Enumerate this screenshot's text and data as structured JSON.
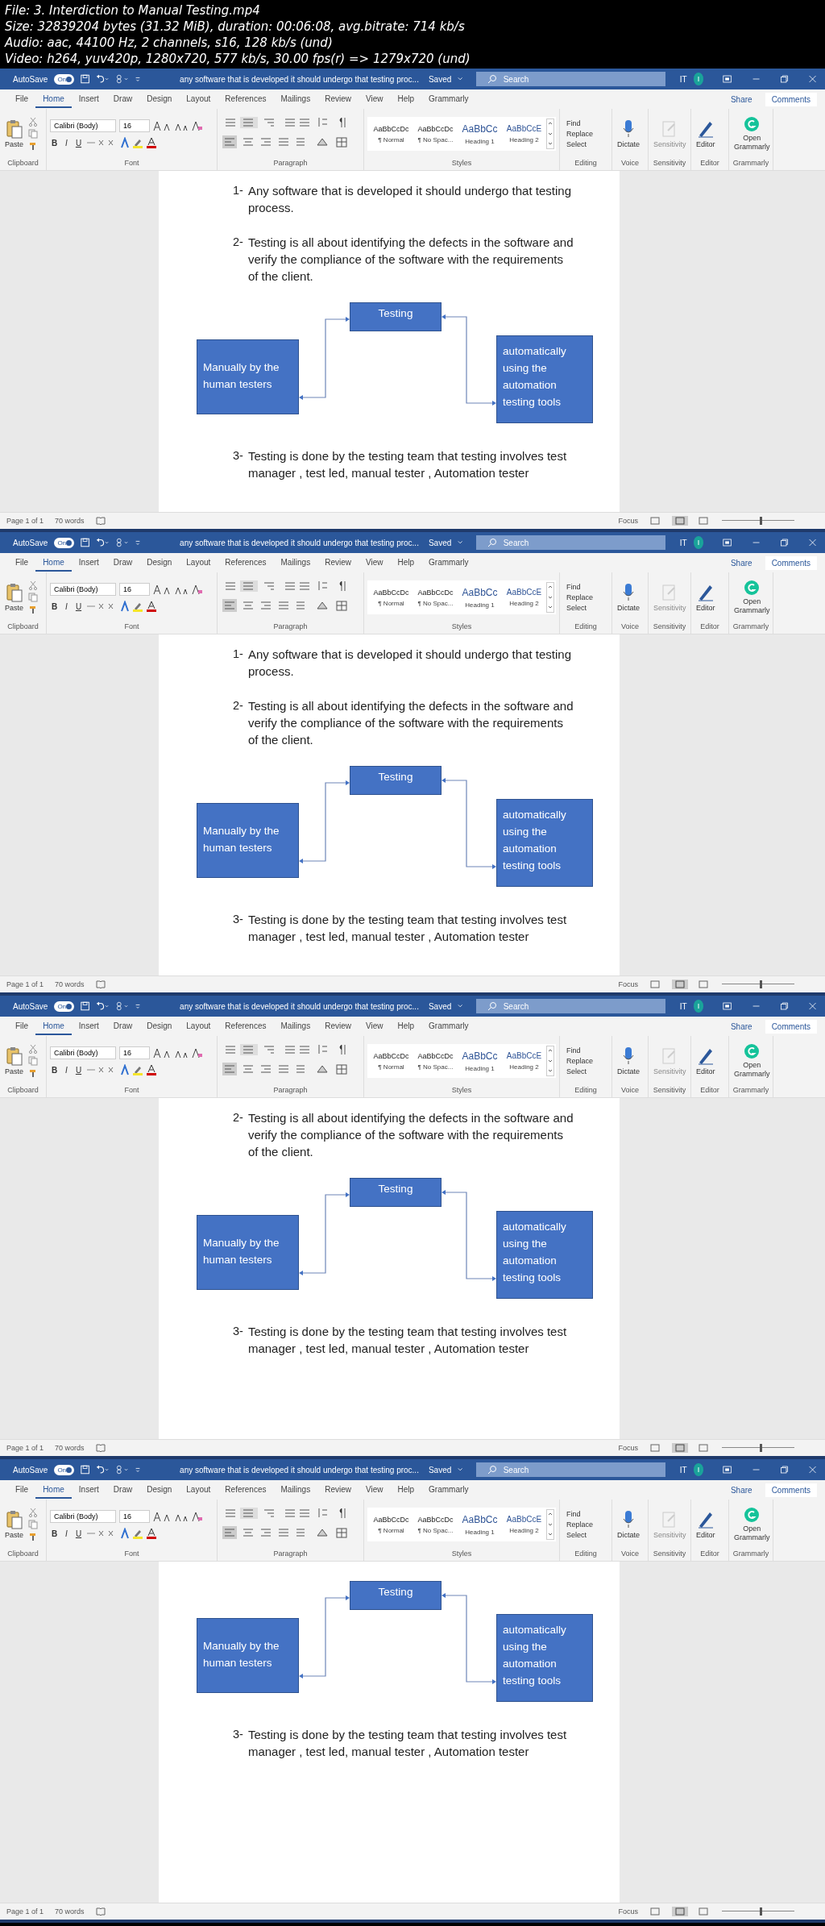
{
  "header": [
    "File: 3. Interdiction to Manual Testing.mp4",
    "Size: 32839204 bytes (31.32 MiB), duration: 00:06:08, avg.bitrate: 714 kb/s",
    "Audio: aac, 44100 Hz, 2 channels, s16, 128 kb/s (und)",
    "Video: h264, yuv420p, 1280x720, 577 kb/s, 30.00 fps(r) => 1279x720 (und)"
  ],
  "frames": [
    {
      "title_bar": {
        "autosave": "AutoSave",
        "toggle": "On",
        "toggle_on": true,
        "doc_title": "any software that is developed it should undergo that testing proc...",
        "saved": "Saved",
        "search": "Search",
        "initials": "IT",
        "avatar": "I"
      },
      "tabs": [
        {
          "label": "File",
          "selected": false
        },
        {
          "label": "Home",
          "selected": true
        },
        {
          "label": "Insert",
          "selected": false
        },
        {
          "label": "Draw",
          "selected": false
        },
        {
          "label": "Design",
          "selected": false
        },
        {
          "label": "Layout",
          "selected": false
        },
        {
          "label": "References",
          "selected": false
        },
        {
          "label": "Mailings",
          "selected": false
        },
        {
          "label": "Review",
          "selected": false
        },
        {
          "label": "View",
          "selected": false
        },
        {
          "label": "Help",
          "selected": false
        },
        {
          "label": "Grammarly",
          "selected": false
        }
      ],
      "share": "Share",
      "comments": "Comments",
      "groups": [
        {
          "kind": "clipboard",
          "label": "Clipboard",
          "button": "Paste"
        },
        {
          "kind": "font",
          "label": "Font",
          "font_name": "Calibri (Body)",
          "font_size": "16",
          "buttons": [
            "B",
            "I",
            "U"
          ]
        },
        {
          "kind": "paragraph",
          "label": "Paragraph"
        },
        {
          "kind": "styles",
          "label": "Styles",
          "styles": [
            {
              "preview": "AaBbCcDc",
              "name": "¶ Normal",
              "kind": "body"
            },
            {
              "preview": "AaBbCcDc",
              "name": "¶ No Spac...",
              "kind": "body"
            },
            {
              "preview": "AaBbCc",
              "name": "Heading 1",
              "kind": "heading1"
            },
            {
              "preview": "AaBbCcE",
              "name": "Heading 2",
              "kind": "heading2"
            }
          ]
        },
        {
          "kind": "editing",
          "label": "Editing",
          "find": "Find",
          "replace": "Replace",
          "select": "Select"
        },
        {
          "kind": "voice",
          "label": "Voice",
          "button": "Dictate"
        },
        {
          "kind": "sensitivity",
          "label": "Sensitivity",
          "button": "Sensitivity",
          "disabled": true
        },
        {
          "kind": "editor",
          "label": "Editor",
          "button": "Editor"
        },
        {
          "kind": "grammarly",
          "label": "Grammarly",
          "button": "Open Grammarly"
        }
      ],
      "blocks": [
        {
          "kind": "item",
          "number": "1-",
          "text": "Any software that is developed it should undergo that testing process."
        },
        {
          "kind": "item",
          "number": "2-",
          "text": "Testing is all about identifying the defects in the software and verify the compliance of the software with the requirements of the client."
        },
        {
          "kind": "diagram",
          "center": "Testing",
          "left": "Manually by the human testers",
          "right": "automatically using the automation testing tools"
        },
        {
          "kind": "item",
          "number": "3-",
          "text": "Testing is done by the testing team that testing involves  test manager , test led, manual tester , Automation tester"
        }
      ],
      "status": {
        "page": "Page 1 of 1",
        "words": "70 words",
        "focus": "Focus",
        "level": 0.52
      }
    },
    {
      "title_bar": {
        "autosave": "AutoSave",
        "toggle": "On",
        "toggle_on": true,
        "doc_title": "any software that is developed it should undergo that testing proc...",
        "saved": "Saved",
        "search": "Search",
        "initials": "IT",
        "avatar": "I"
      },
      "tabs": [
        {
          "label": "File",
          "selected": false
        },
        {
          "label": "Home",
          "selected": true
        },
        {
          "label": "Insert",
          "selected": false
        },
        {
          "label": "Draw",
          "selected": false
        },
        {
          "label": "Design",
          "selected": false
        },
        {
          "label": "Layout",
          "selected": false
        },
        {
          "label": "References",
          "selected": false
        },
        {
          "label": "Mailings",
          "selected": false
        },
        {
          "label": "Review",
          "selected": false
        },
        {
          "label": "View",
          "selected": false
        },
        {
          "label": "Help",
          "selected": false
        },
        {
          "label": "Grammarly",
          "selected": false
        }
      ],
      "share": "Share",
      "comments": "Comments",
      "groups": [
        {
          "kind": "clipboard",
          "label": "Clipboard",
          "button": "Paste"
        },
        {
          "kind": "font",
          "label": "Font",
          "font_name": "Calibri (Body)",
          "font_size": "16",
          "buttons": [
            "B",
            "I",
            "U"
          ]
        },
        {
          "kind": "paragraph",
          "label": "Paragraph"
        },
        {
          "kind": "styles",
          "label": "Styles",
          "styles": [
            {
              "preview": "AaBbCcDc",
              "name": "¶ Normal",
              "kind": "body"
            },
            {
              "preview": "AaBbCcDc",
              "name": "¶ No Spac...",
              "kind": "body"
            },
            {
              "preview": "AaBbCc",
              "name": "Heading 1",
              "kind": "heading1"
            },
            {
              "preview": "AaBbCcE",
              "name": "Heading 2",
              "kind": "heading2"
            }
          ]
        },
        {
          "kind": "editing",
          "label": "Editing",
          "find": "Find",
          "replace": "Replace",
          "select": "Select"
        },
        {
          "kind": "voice",
          "label": "Voice",
          "button": "Dictate"
        },
        {
          "kind": "sensitivity",
          "label": "Sensitivity",
          "button": "Sensitivity",
          "disabled": true
        },
        {
          "kind": "editor",
          "label": "Editor",
          "button": "Editor"
        },
        {
          "kind": "grammarly",
          "label": "Grammarly",
          "button": "Open Grammarly"
        }
      ],
      "blocks": [
        {
          "kind": "item",
          "number": "1-",
          "text": "Any software that is developed it should undergo that testing process."
        },
        {
          "kind": "item",
          "number": "2-",
          "text": "Testing is all about identifying the defects in the software and verify the compliance of the software with the requirements of the client."
        },
        {
          "kind": "diagram",
          "center": "Testing",
          "left": "Manually by the human testers",
          "right": "automatically using the automation testing tools"
        },
        {
          "kind": "item",
          "number": "3-",
          "text": "Testing is done by the testing team that testing involves  test manager , test led, manual tester , Automation tester"
        }
      ],
      "status": {
        "page": "Page 1 of 1",
        "words": "70 words",
        "focus": "Focus",
        "level": 0.52
      }
    },
    {
      "title_bar": {
        "autosave": "AutoSave",
        "toggle": "On",
        "toggle_on": true,
        "doc_title": "any software that is developed it should undergo that testing proc...",
        "saved": "Saved",
        "search": "Search",
        "initials": "IT",
        "avatar": "I"
      },
      "tabs": [
        {
          "label": "File",
          "selected": false
        },
        {
          "label": "Home",
          "selected": true
        },
        {
          "label": "Insert",
          "selected": false
        },
        {
          "label": "Draw",
          "selected": false
        },
        {
          "label": "Design",
          "selected": false
        },
        {
          "label": "Layout",
          "selected": false
        },
        {
          "label": "References",
          "selected": false
        },
        {
          "label": "Mailings",
          "selected": false
        },
        {
          "label": "Review",
          "selected": false
        },
        {
          "label": "View",
          "selected": false
        },
        {
          "label": "Help",
          "selected": false
        },
        {
          "label": "Grammarly",
          "selected": false
        }
      ],
      "share": "Share",
      "comments": "Comments",
      "groups": [
        {
          "kind": "clipboard",
          "label": "Clipboard",
          "button": "Paste"
        },
        {
          "kind": "font",
          "label": "Font",
          "font_name": "Calibri (Body)",
          "font_size": "16",
          "buttons": [
            "B",
            "I",
            "U"
          ]
        },
        {
          "kind": "paragraph",
          "label": "Paragraph"
        },
        {
          "kind": "styles",
          "label": "Styles",
          "styles": [
            {
              "preview": "AaBbCcDc",
              "name": "¶ Normal",
              "kind": "body"
            },
            {
              "preview": "AaBbCcDc",
              "name": "¶ No Spac...",
              "kind": "body"
            },
            {
              "preview": "AaBbCc",
              "name": "Heading 1",
              "kind": "heading1"
            },
            {
              "preview": "AaBbCcE",
              "name": "Heading 2",
              "kind": "heading2"
            }
          ]
        },
        {
          "kind": "editing",
          "label": "Editing",
          "find": "Find",
          "replace": "Replace",
          "select": "Select"
        },
        {
          "kind": "voice",
          "label": "Voice",
          "button": "Dictate"
        },
        {
          "kind": "sensitivity",
          "label": "Sensitivity",
          "button": "Sensitivity",
          "disabled": true
        },
        {
          "kind": "editor",
          "label": "Editor",
          "button": "Editor"
        },
        {
          "kind": "grammarly",
          "label": "Grammarly",
          "button": "Open Grammarly"
        }
      ],
      "blocks": [
        {
          "kind": "item",
          "number": "2-",
          "text": "Testing is all about identifying the defects in the software and verify the compliance of the software with the requirements of the client."
        },
        {
          "kind": "diagram",
          "center": "Testing",
          "left": "Manually by the human testers",
          "right": "automatically using the automation testing tools"
        },
        {
          "kind": "item",
          "number": "3-",
          "text": "Testing is done by the testing team that testing involves  test manager , test led, manual tester , Automation tester"
        }
      ],
      "status": {
        "page": "Page 1 of 1",
        "words": "70 words",
        "focus": "Focus",
        "level": 0.52
      }
    },
    {
      "title_bar": {
        "autosave": "AutoSave",
        "toggle": "On",
        "toggle_on": true,
        "doc_title": "any software that is developed it should undergo that testing proc...",
        "saved": "Saved",
        "search": "Search",
        "initials": "IT",
        "avatar": "I"
      },
      "tabs": [
        {
          "label": "File",
          "selected": false
        },
        {
          "label": "Home",
          "selected": true
        },
        {
          "label": "Insert",
          "selected": false
        },
        {
          "label": "Draw",
          "selected": false
        },
        {
          "label": "Design",
          "selected": false
        },
        {
          "label": "Layout",
          "selected": false
        },
        {
          "label": "References",
          "selected": false
        },
        {
          "label": "Mailings",
          "selected": false
        },
        {
          "label": "Review",
          "selected": false
        },
        {
          "label": "View",
          "selected": false
        },
        {
          "label": "Help",
          "selected": false
        },
        {
          "label": "Grammarly",
          "selected": false
        }
      ],
      "share": "Share",
      "comments": "Comments",
      "groups": [
        {
          "kind": "clipboard",
          "label": "Clipboard",
          "button": "Paste"
        },
        {
          "kind": "font",
          "label": "Font",
          "font_name": "Calibri (Body)",
          "font_size": "16",
          "buttons": [
            "B",
            "I",
            "U"
          ]
        },
        {
          "kind": "paragraph",
          "label": "Paragraph"
        },
        {
          "kind": "styles",
          "label": "Styles",
          "styles": [
            {
              "preview": "AaBbCcDc",
              "name": "¶ Normal",
              "kind": "body"
            },
            {
              "preview": "AaBbCcDc",
              "name": "¶ No Spac...",
              "kind": "body"
            },
            {
              "preview": "AaBbCc",
              "name": "Heading 1",
              "kind": "heading1"
            },
            {
              "preview": "AaBbCcE",
              "name": "Heading 2",
              "kind": "heading2"
            }
          ]
        },
        {
          "kind": "editing",
          "label": "Editing",
          "find": "Find",
          "replace": "Replace",
          "select": "Select"
        },
        {
          "kind": "voice",
          "label": "Voice",
          "button": "Dictate"
        },
        {
          "kind": "sensitivity",
          "label": "Sensitivity",
          "button": "Sensitivity",
          "disabled": true
        },
        {
          "kind": "editor",
          "label": "Editor",
          "button": "Editor"
        },
        {
          "kind": "grammarly",
          "label": "Grammarly",
          "button": "Open Grammarly"
        }
      ],
      "blocks": [
        {
          "kind": "diagram",
          "center": "Testing",
          "left": "Manually by the human testers",
          "right": "automatically using the automation testing tools"
        },
        {
          "kind": "item",
          "number": "3-",
          "text": "Testing is done by the testing team that testing involves  test manager , test led, manual tester , Automation tester"
        }
      ],
      "status": {
        "page": "Page 1 of 1",
        "words": "70 words",
        "focus": "Focus",
        "level": 0.52
      }
    }
  ]
}
